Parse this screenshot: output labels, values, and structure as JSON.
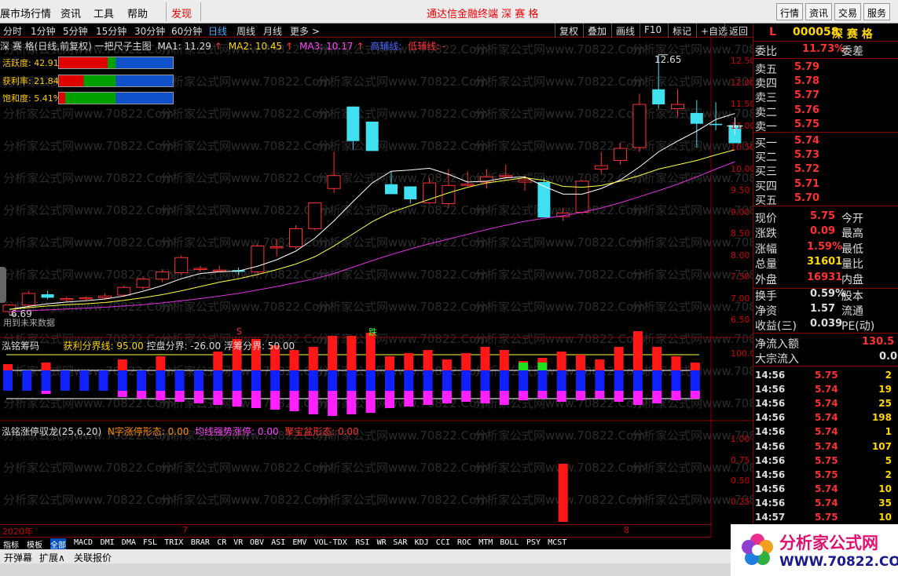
{
  "menu": {
    "items": [
      "展市场行情",
      "资讯",
      "工具",
      "帮助",
      "发现"
    ],
    "title": "通达信金融终端  深 赛 格",
    "right_buttons": [
      "行情",
      "资讯",
      "交易",
      "服务"
    ]
  },
  "periods": [
    "分时",
    "1分钟",
    "5分钟",
    "15分钟",
    "30分钟",
    "60分钟",
    "日线",
    "周线",
    "月线",
    "更多 >"
  ],
  "active_period": "日线",
  "toolbar": [
    "复权",
    "叠加",
    "画线",
    "F10",
    "标记",
    "+自选",
    "返回"
  ],
  "chart_header": {
    "name": "深 赛 格(日线,前复权) 一把尺子主图",
    "ma1": "MA1: 11.29",
    "ma2": "MA2: 10.45",
    "ma3": "MA3: 10.17",
    "gao": "高辅线:",
    "di": "低辅线: -"
  },
  "gauges": [
    {
      "label": "活跃度: 42.91%",
      "fraction": 0.4291
    },
    {
      "label": "获利率: 21.84%",
      "fraction": 0.2184
    },
    {
      "label": "饱和度: 5.41%",
      "fraction": 0.0541
    }
  ],
  "annotations": {
    "high": "12.65",
    "low": "6.69",
    "future": "用到未来数据",
    "s_mark": "S",
    "die_mark": "跌"
  },
  "price_axis": [
    "12.50",
    "12.00",
    "11.50",
    "11.00",
    "10.50",
    "10.00",
    "9.50",
    "9.00",
    "8.50",
    "8.00",
    "7.50",
    "7.00",
    "6.50"
  ],
  "sub1": {
    "name": "泓铭筹码",
    "l1": "获利分界线: 95.00",
    "l2": "控盘分界: -26.00",
    "l3": "浮筹分界: 50.00",
    "axis": "100.0"
  },
  "sub2": {
    "name": "泓铭涨停驭龙(25,6,20)",
    "l1": "N字涨停形态: 0.00",
    "l2": "均线强势涨停: 0.00",
    "l3": "聚宝盆形态: 0.00",
    "axis": [
      "1.00",
      "0.75",
      "0.50",
      "0.25"
    ]
  },
  "date_axis": [
    "2020年",
    "7",
    "8"
  ],
  "indicator_tabs": [
    "指标",
    "模板",
    "全部",
    "MACD",
    "DMI",
    "DMA",
    "FSL",
    "TRIX",
    "BRAR",
    "CR",
    "VR",
    "OBV",
    "ASI",
    "EMV",
    "VOL-TDX",
    "RSI",
    "WR",
    "SAR",
    "KDJ",
    "CCI",
    "ROC",
    "MTM",
    "BOLL",
    "PSY",
    "MCST"
  ],
  "bottom_tabs": [
    "开弹幕",
    "扩展∧",
    "关联报价"
  ],
  "watermark": "分析家公式网www.70822.Com",
  "quote": {
    "mark": "L",
    "code": "000058",
    "name": "深 赛 格",
    "weibi_label": "委比",
    "weibi": "11.73%",
    "weicha_label": "委差",
    "sells": [
      {
        "label": "卖五",
        "price": "5.79"
      },
      {
        "label": "卖四",
        "price": "5.78"
      },
      {
        "label": "卖三",
        "price": "5.77"
      },
      {
        "label": "卖二",
        "price": "5.76"
      },
      {
        "label": "卖一",
        "price": "5.75"
      }
    ],
    "buys": [
      {
        "label": "买一",
        "price": "5.74"
      },
      {
        "label": "买二",
        "price": "5.73"
      },
      {
        "label": "买三",
        "price": "5.72"
      },
      {
        "label": "买四",
        "price": "5.71"
      },
      {
        "label": "买五",
        "price": "5.70"
      }
    ],
    "stats": [
      {
        "l": "现价",
        "v": "5.75",
        "r": "今开"
      },
      {
        "l": "涨跌",
        "v": "0.09",
        "r": "最高"
      },
      {
        "l": "涨幅",
        "v": "1.59%",
        "r": "最低"
      },
      {
        "l": "总量",
        "v": "31601",
        "r": "量比"
      },
      {
        "l": "外盘",
        "v": "16931",
        "r": "内盘"
      },
      {
        "l": "换手",
        "v": "0.59%",
        "r": "股本"
      },
      {
        "l": "净资",
        "v": "1.57",
        "r": "流通"
      },
      {
        "l": "收益(三)",
        "v": "0.039",
        "r": "PE(动)"
      }
    ],
    "net_inflow_label": "净流入额",
    "net_inflow": "130.5",
    "block_label": "大宗流入",
    "block": "0.0",
    "ticks": [
      {
        "t": "14:56",
        "p": "5.75",
        "v": "2"
      },
      {
        "t": "14:56",
        "p": "5.74",
        "v": "19"
      },
      {
        "t": "14:56",
        "p": "5.74",
        "v": "25"
      },
      {
        "t": "14:56",
        "p": "5.74",
        "v": "198"
      },
      {
        "t": "14:56",
        "p": "5.74",
        "v": "1"
      },
      {
        "t": "14:56",
        "p": "5.74",
        "v": "107"
      },
      {
        "t": "14:56",
        "p": "5.75",
        "v": "5"
      },
      {
        "t": "14:56",
        "p": "5.75",
        "v": "2"
      },
      {
        "t": "14:56",
        "p": "5.74",
        "v": "10"
      },
      {
        "t": "14:56",
        "p": "5.74",
        "v": "35"
      },
      {
        "t": "14:57",
        "p": "5.75",
        "v": "10"
      }
    ]
  },
  "logo": {
    "cn": "分析家公式网",
    "url": "WWW.70822.COM"
  },
  "chart_data": {
    "type": "candlestick",
    "candles": [
      [
        6.7,
        6.88,
        6.62,
        6.85
      ],
      [
        6.85,
        7.18,
        6.8,
        7.12
      ],
      [
        7.1,
        7.18,
        6.98,
        7.02
      ],
      [
        6.98,
        7.05,
        6.92,
        7.0
      ],
      [
        7.0,
        7.05,
        6.96,
        7.02
      ],
      [
        7.02,
        7.12,
        7.0,
        7.06
      ],
      [
        7.08,
        7.3,
        7.05,
        7.26
      ],
      [
        7.26,
        7.52,
        7.2,
        7.45
      ],
      [
        7.45,
        7.68,
        7.38,
        7.62
      ],
      [
        7.6,
        8.0,
        7.55,
        7.95
      ],
      [
        7.7,
        7.76,
        7.62,
        7.7
      ],
      [
        7.66,
        7.76,
        7.62,
        7.66
      ],
      [
        7.66,
        7.72,
        7.55,
        7.62
      ],
      [
        7.62,
        8.26,
        7.58,
        8.22
      ],
      [
        8.2,
        8.38,
        7.98,
        8.2
      ],
      [
        8.2,
        8.7,
        8.15,
        8.62
      ],
      [
        8.62,
        9.22,
        8.58,
        9.22
      ],
      [
        9.55,
        10.4,
        9.45,
        9.85
      ],
      [
        11.45,
        11.45,
        10.45,
        10.65
      ],
      [
        11.1,
        11.1,
        10.5,
        10.42
      ],
      [
        9.65,
        9.95,
        9.45,
        9.42
      ],
      [
        9.6,
        9.6,
        9.2,
        9.3
      ],
      [
        9.22,
        9.8,
        9.18,
        9.68
      ],
      [
        9.2,
        10.0,
        9.1,
        9.62
      ],
      [
        9.65,
        9.95,
        9.6,
        9.65
      ],
      [
        9.7,
        10.0,
        9.55,
        9.82
      ],
      [
        9.85,
        10.1,
        9.8,
        9.85
      ],
      [
        9.7,
        9.85,
        9.5,
        9.75
      ],
      [
        9.7,
        9.8,
        9.0,
        8.88
      ],
      [
        8.9,
        9.1,
        8.8,
        8.98
      ],
      [
        9.0,
        9.75,
        8.95,
        9.72
      ],
      [
        10.0,
        10.4,
        9.9,
        10.08
      ],
      [
        10.2,
        10.6,
        10.1,
        10.48
      ],
      [
        10.5,
        11.75,
        10.4,
        11.5
      ],
      [
        11.85,
        12.65,
        11.4,
        11.5
      ],
      [
        11.4,
        11.85,
        11.2,
        11.5
      ],
      [
        11.3,
        11.6,
        10.5,
        11.05
      ],
      [
        11.05,
        11.55,
        10.9,
        11.02
      ],
      [
        11.02,
        11.1,
        10.65,
        10.6
      ]
    ],
    "ma1": [
      6.75,
      6.82,
      6.88,
      6.92,
      6.95,
      6.99,
      7.06,
      7.17,
      7.3,
      7.46,
      7.58,
      7.62,
      7.64,
      7.75,
      7.9,
      8.1,
      8.4,
      8.8,
      9.25,
      9.68,
      9.95,
      9.98,
      10.02,
      9.88,
      9.7,
      9.72,
      9.8,
      9.82,
      9.6,
      9.42,
      9.42,
      9.55,
      9.75,
      10.05,
      10.4,
      10.65,
      10.88,
      11.15,
      11.29
    ],
    "ma2": [
      6.75,
      6.79,
      6.83,
      6.86,
      6.88,
      6.91,
      6.96,
      7.02,
      7.09,
      7.18,
      7.28,
      7.38,
      7.46,
      7.56,
      7.67,
      7.8,
      7.97,
      8.22,
      8.5,
      8.78,
      9.0,
      9.15,
      9.3,
      9.45,
      9.58,
      9.68,
      9.74,
      9.8,
      9.74,
      9.6,
      9.58,
      9.62,
      9.72,
      9.85,
      10.0,
      10.1,
      10.2,
      10.33,
      10.45
    ],
    "ma3": [
      6.7,
      6.72,
      6.74,
      6.76,
      6.78,
      6.8,
      6.83,
      6.86,
      6.9,
      6.95,
      7.0,
      7.06,
      7.12,
      7.2,
      7.28,
      7.37,
      7.46,
      7.58,
      7.73,
      7.88,
      8.02,
      8.15,
      8.27,
      8.38,
      8.49,
      8.6,
      8.7,
      8.79,
      8.86,
      8.92,
      9.0,
      9.1,
      9.22,
      9.36,
      9.5,
      9.65,
      9.82,
      10.0,
      10.17
    ],
    "sub2_values": {
      "index": 29,
      "value": 1.0
    }
  }
}
